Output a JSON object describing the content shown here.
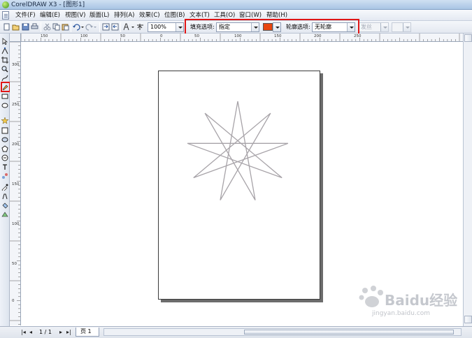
{
  "window": {
    "title": "CorelDRAW X3 - [图形1]"
  },
  "menu": {
    "items": [
      "文件(F)",
      "编辑(E)",
      "视图(V)",
      "版面(L)",
      "排列(A)",
      "效果(C)",
      "位图(B)",
      "文本(T)",
      "工具(O)",
      "窗口(W)",
      "帮助(H)"
    ]
  },
  "toolbar": {
    "zoom_value": "100%",
    "fill_label": "填充选项:",
    "fill_value": "指定",
    "fill_color": "#e8460f",
    "outline_label": "轮廓选项:",
    "outline_value": "无轮廓",
    "outline_width_value": "发丝"
  },
  "rulers": {
    "horizontal_labels": [
      "150",
      "100",
      "50",
      "0",
      "50",
      "100",
      "150",
      "200",
      "250"
    ],
    "vertical_labels": [
      "300",
      "250",
      "200",
      "150",
      "100",
      "50",
      "0"
    ]
  },
  "drawing": {
    "shape": "star-9-point",
    "star_points": 9,
    "stroke_color": "#a7a3a8",
    "accent_color": "#e01515"
  },
  "status": {
    "page_count": "1 / 1",
    "page_tab": "页 1"
  },
  "watermark": {
    "brand_text": "Baidu经验",
    "url_text": "jingyan.baidu.com"
  }
}
